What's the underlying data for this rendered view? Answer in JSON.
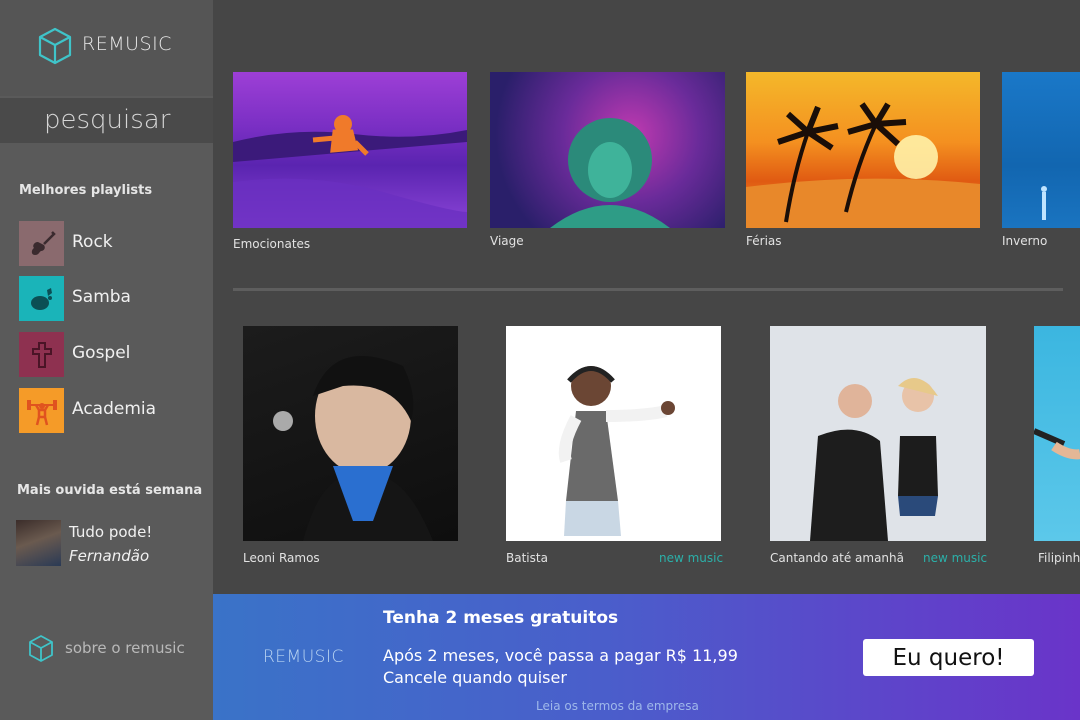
{
  "brand": {
    "name": "REMUSIC",
    "icon": "cube-icon",
    "accent": "#3fc4c9"
  },
  "search": {
    "label": "pesquisar"
  },
  "sidebar": {
    "playlists_title": "Melhores playlists",
    "playlists": [
      {
        "label": "Rock",
        "icon": "guitar-icon",
        "color": "#8a6a6e"
      },
      {
        "label": "Samba",
        "icon": "tambourine-icon",
        "color": "#1ab4b9"
      },
      {
        "label": "Gospel",
        "icon": "cross-icon",
        "color": "#8e3150"
      },
      {
        "label": "Academia",
        "icon": "weightlifter-icon",
        "color": "#f59b28"
      }
    ],
    "most_played_title": "Mais ouvida está semana",
    "most_played": {
      "song": "Tudo pode!",
      "artist": "Fernandão"
    },
    "about": "sobre o remusic"
  },
  "moods": [
    {
      "label": "Emocionates"
    },
    {
      "label": "Viage"
    },
    {
      "label": "Férias"
    },
    {
      "label": "Inverno"
    }
  ],
  "artists": [
    {
      "label": "Leoni Ramos",
      "tag": ""
    },
    {
      "label": "Batista",
      "tag": "new music"
    },
    {
      "label": "Cantando até amanhã",
      "tag": "new music"
    },
    {
      "label": "Filipinh",
      "tag": ""
    }
  ],
  "banner": {
    "brand": "REMUSIC",
    "headline": "Tenha 2 meses gratuitos",
    "line1": "Após 2 meses, você passa a pagar R$ 11,99",
    "line2": "Cancele quando quiser",
    "terms": "Leia os termos da empresa",
    "cta": "Eu quero!"
  }
}
